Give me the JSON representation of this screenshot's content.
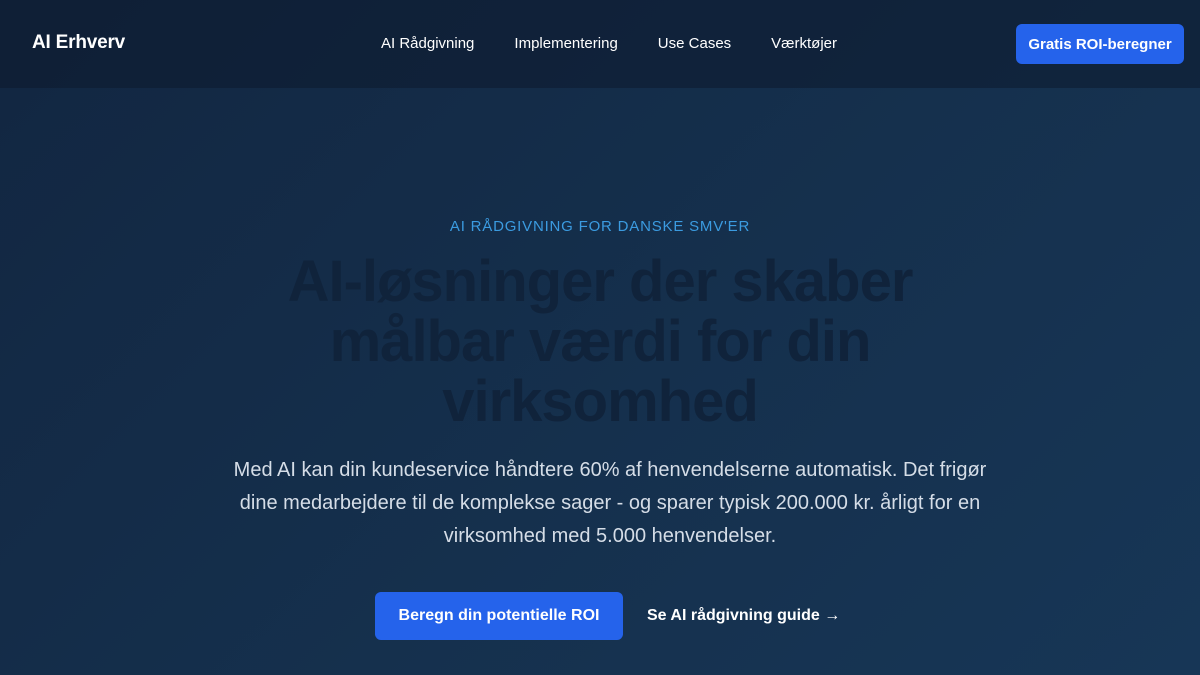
{
  "header": {
    "logo": "AI Erhverv",
    "nav": [
      {
        "label": "AI Rådgivning"
      },
      {
        "label": "Implementering"
      },
      {
        "label": "Use Cases"
      },
      {
        "label": "Værktøjer"
      }
    ],
    "cta_label": "Gratis ROI-beregner"
  },
  "hero": {
    "eyebrow": "AI RÅDGIVNING FOR DANSKE SMV'ER",
    "headline": "AI-løsninger der skaber målbar værdi for din virksomhed",
    "lead": "Med AI kan din kundeservice håndtere 60% af henvendelserne automatisk. Det frigør dine medarbejdere til de komplekse sager - og sparer typisk 200.000 kr. årligt for en virksomhed med 5.000 henvendelser.",
    "primary_cta": "Beregn din potentielle ROI",
    "secondary_cta": "Se AI rådgivning guide →"
  },
  "colors": {
    "accent": "#2563eb",
    "eyebrow": "#3b9be0",
    "background": "#15304d"
  }
}
